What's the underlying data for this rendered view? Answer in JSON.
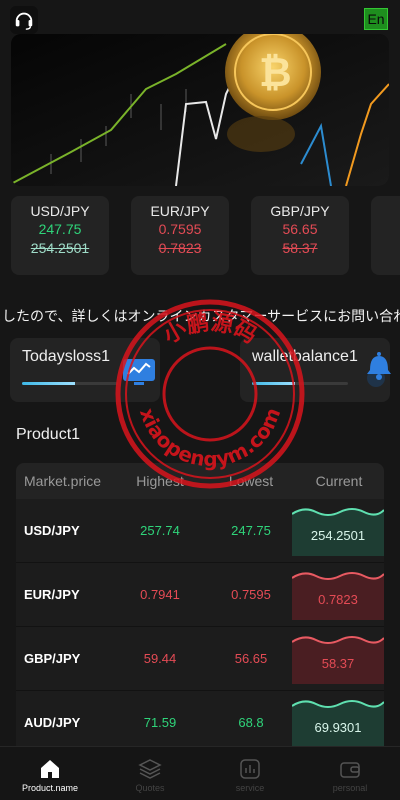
{
  "header": {
    "support_icon": "headset-icon",
    "language_label": "En"
  },
  "tickers": [
    {
      "pair": "USD/JPY",
      "price": "247.75",
      "prev": "254.2501",
      "trend": "up"
    },
    {
      "pair": "EUR/JPY",
      "price": "0.7595",
      "prev": "0.7823",
      "trend": "down"
    },
    {
      "pair": "GBP/JPY",
      "price": "56.65",
      "prev": "58.37",
      "trend": "down"
    }
  ],
  "notice": "ましたので、詳しくはオンラインカスタマーサービスにお問い合わ",
  "stats": {
    "loss_label": "Todaysloss1",
    "wallet_label": "walletbalance1",
    "loss_icon": "monitor-chart-icon",
    "wallet_icon": "bell-icon"
  },
  "section_title": "Product1",
  "table": {
    "headers": [
      "Market.price",
      "Highest",
      "Lowest",
      "Current"
    ],
    "rows": [
      {
        "pair": "USD/JPY",
        "high": "257.74",
        "low": "247.75",
        "current": "254.2501",
        "trend": "up"
      },
      {
        "pair": "EUR/JPY",
        "high": "0.7941",
        "low": "0.7595",
        "current": "0.7823",
        "trend": "down"
      },
      {
        "pair": "GBP/JPY",
        "high": "59.44",
        "low": "56.65",
        "current": "58.37",
        "trend": "down"
      },
      {
        "pair": "AUD/JPY",
        "high": "71.59",
        "low": "68.8",
        "current": "69.9301",
        "trend": "up"
      }
    ]
  },
  "tabbar": [
    {
      "label": "Product.name",
      "icon": "home-icon",
      "active": true
    },
    {
      "label": "Quotes",
      "icon": "layers-icon",
      "active": false
    },
    {
      "label": "service",
      "icon": "chart-box-icon",
      "active": false
    },
    {
      "label": "personal",
      "icon": "wallet-icon",
      "active": false
    }
  ],
  "watermark": {
    "top_text": "小鹏源码",
    "bottom_text": "xiaopengym.com"
  },
  "colors": {
    "up": "#2fd47a",
    "down": "#e44b55",
    "accent": "#3db8e6",
    "background": "#161616"
  }
}
